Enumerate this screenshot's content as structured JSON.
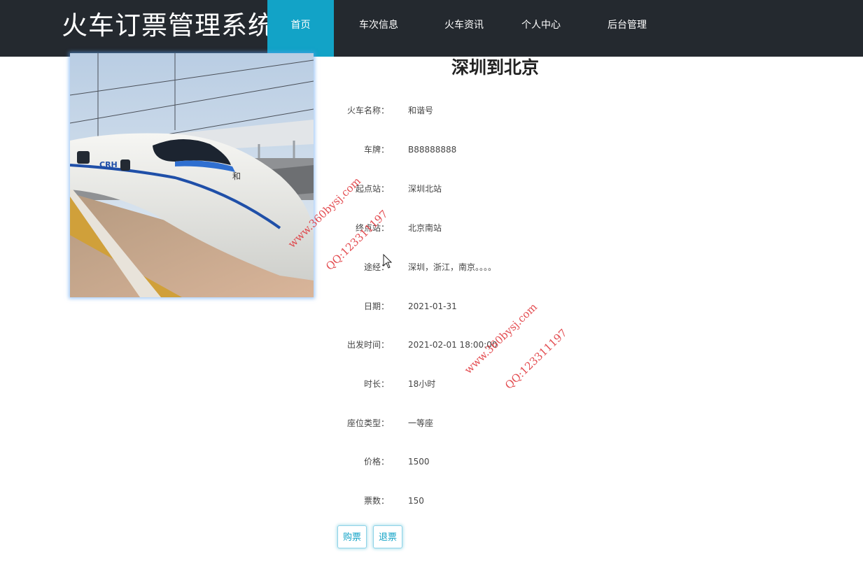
{
  "app": {
    "title": "火车订票管理系统"
  },
  "nav": {
    "items": [
      {
        "label": "首页",
        "active": true
      },
      {
        "label": "车次信息",
        "active": false
      },
      {
        "label": "火车资讯",
        "active": false
      },
      {
        "label": "个人中心",
        "active": false
      },
      {
        "label": "后台管理",
        "active": false
      }
    ]
  },
  "detail": {
    "title": "深圳到北京",
    "fields": [
      {
        "label": "火车名称：",
        "value": "和谐号"
      },
      {
        "label": "车牌：",
        "value": "B88888888"
      },
      {
        "label": "起点站：",
        "value": "深圳北站"
      },
      {
        "label": "终点站：",
        "value": "北京南站"
      },
      {
        "label": "途经：",
        "value": "深圳，浙江，南京。。。。"
      },
      {
        "label": "日期：",
        "value": "2021-01-31"
      },
      {
        "label": "出发时间：",
        "value": "2021-02-01 18:00:00"
      },
      {
        "label": "时长：",
        "value": "18小时"
      },
      {
        "label": "座位类型：",
        "value": "一等座"
      },
      {
        "label": "价格：",
        "value": "1500"
      },
      {
        "label": "票数：",
        "value": "150"
      }
    ]
  },
  "actions": {
    "buy_label": "购票",
    "refund_label": "退票"
  },
  "watermarks": {
    "site": "www.360bysj.com",
    "qq": "QQ:123311197"
  },
  "colors": {
    "header_bg": "#24292f",
    "accent": "#12a3c7",
    "watermark": "#e0393e"
  },
  "icons": {
    "cursor": "mouse-pointer-icon",
    "photo": "high-speed-train-image"
  }
}
